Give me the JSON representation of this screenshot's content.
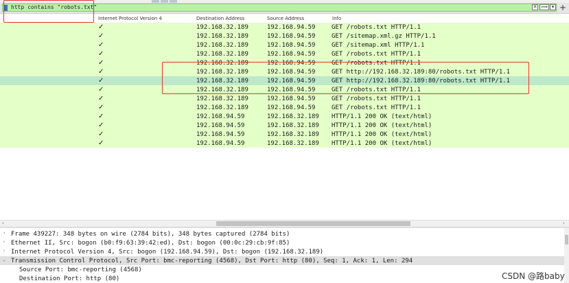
{
  "filter": {
    "value": "http contains \"robots.txt\"",
    "clear_label": "✕",
    "apply_label": "⟹",
    "dropdown_label": "▾",
    "add_label": "+"
  },
  "columns": [
    "Internet Protocol Version 4",
    "Destination Address",
    "Source Address",
    "Info"
  ],
  "check_mark": "✓",
  "packets": [
    {
      "dst": "192.168.32.189",
      "src": "192.168.94.59",
      "info": "GET /robots.txt HTTP/1.1"
    },
    {
      "dst": "192.168.32.189",
      "src": "192.168.94.59",
      "info": "GET /sitemap.xml.gz HTTP/1.1"
    },
    {
      "dst": "192.168.32.189",
      "src": "192.168.94.59",
      "info": "GET /sitemap.xml HTTP/1.1"
    },
    {
      "dst": "192.168.32.189",
      "src": "192.168.94.59",
      "info": "GET /robots.txt HTTP/1.1"
    },
    {
      "dst": "192.168.32.189",
      "src": "192.168.94.59",
      "info": "GET /robots.txt HTTP/1.1"
    },
    {
      "dst": "192.168.32.189",
      "src": "192.168.94.59",
      "info": "GET http://192.168.32.189:80/robots.txt HTTP/1.1"
    },
    {
      "dst": "192.168.32.189",
      "src": "192.168.94.59",
      "info": "GET http://192.168.32.189:80/robots.txt HTTP/1.1",
      "selected": true
    },
    {
      "dst": "192.168.32.189",
      "src": "192.168.94.59",
      "info": "GET /robots.txt HTTP/1.1"
    },
    {
      "dst": "192.168.32.189",
      "src": "192.168.94.59",
      "info": "GET /robots.txt HTTP/1.1"
    },
    {
      "dst": "192.168.32.189",
      "src": "192.168.94.59",
      "info": "GET /robots.txt HTTP/1.1"
    },
    {
      "dst": "192.168.94.59",
      "src": "192.168.32.189",
      "info": "HTTP/1.1 200 OK  (text/html)"
    },
    {
      "dst": "192.168.94.59",
      "src": "192.168.32.189",
      "info": "HTTP/1.1 200 OK  (text/html)"
    },
    {
      "dst": "192.168.94.59",
      "src": "192.168.32.189",
      "info": "HTTP/1.1 200 OK  (text/html)"
    },
    {
      "dst": "192.168.94.59",
      "src": "192.168.32.189",
      "info": "HTTP/1.1 200 OK  (text/html)"
    }
  ],
  "scroll_left": "‹",
  "scroll_right": "›",
  "details": [
    {
      "twisty": "›",
      "text": "Frame 439227: 348 bytes on wire (2784 bits), 348 bytes captured (2784 bits)"
    },
    {
      "twisty": "›",
      "text": "Ethernet II, Src: bogon (b0:f9:63:39:42:ed), Dst: bogon (00:0c:29:cb:9f:85)"
    },
    {
      "twisty": "›",
      "text": "Internet Protocol Version 4, Src: bogon (192.168.94.59), Dst: bogon (192.168.32.189)"
    },
    {
      "twisty": "⌄",
      "text": "Transmission Control Protocol, Src Port: bmc-reporting (4568), Dst Port: http (80), Seq: 1, Ack: 1, Len: 294",
      "highlight": true
    },
    {
      "twisty": "",
      "text": "Source Port: bmc-reporting (4568)",
      "indent": 1
    },
    {
      "twisty": "",
      "text": "Destination Port: http (80)",
      "indent": 1
    }
  ],
  "watermark": "CSDN @路baby",
  "colors": {
    "row_bg": "#e4ffc7",
    "row_selected": "#bde8c9",
    "filter_bg": "#b9f2a6",
    "annotation": "#e8332b"
  }
}
